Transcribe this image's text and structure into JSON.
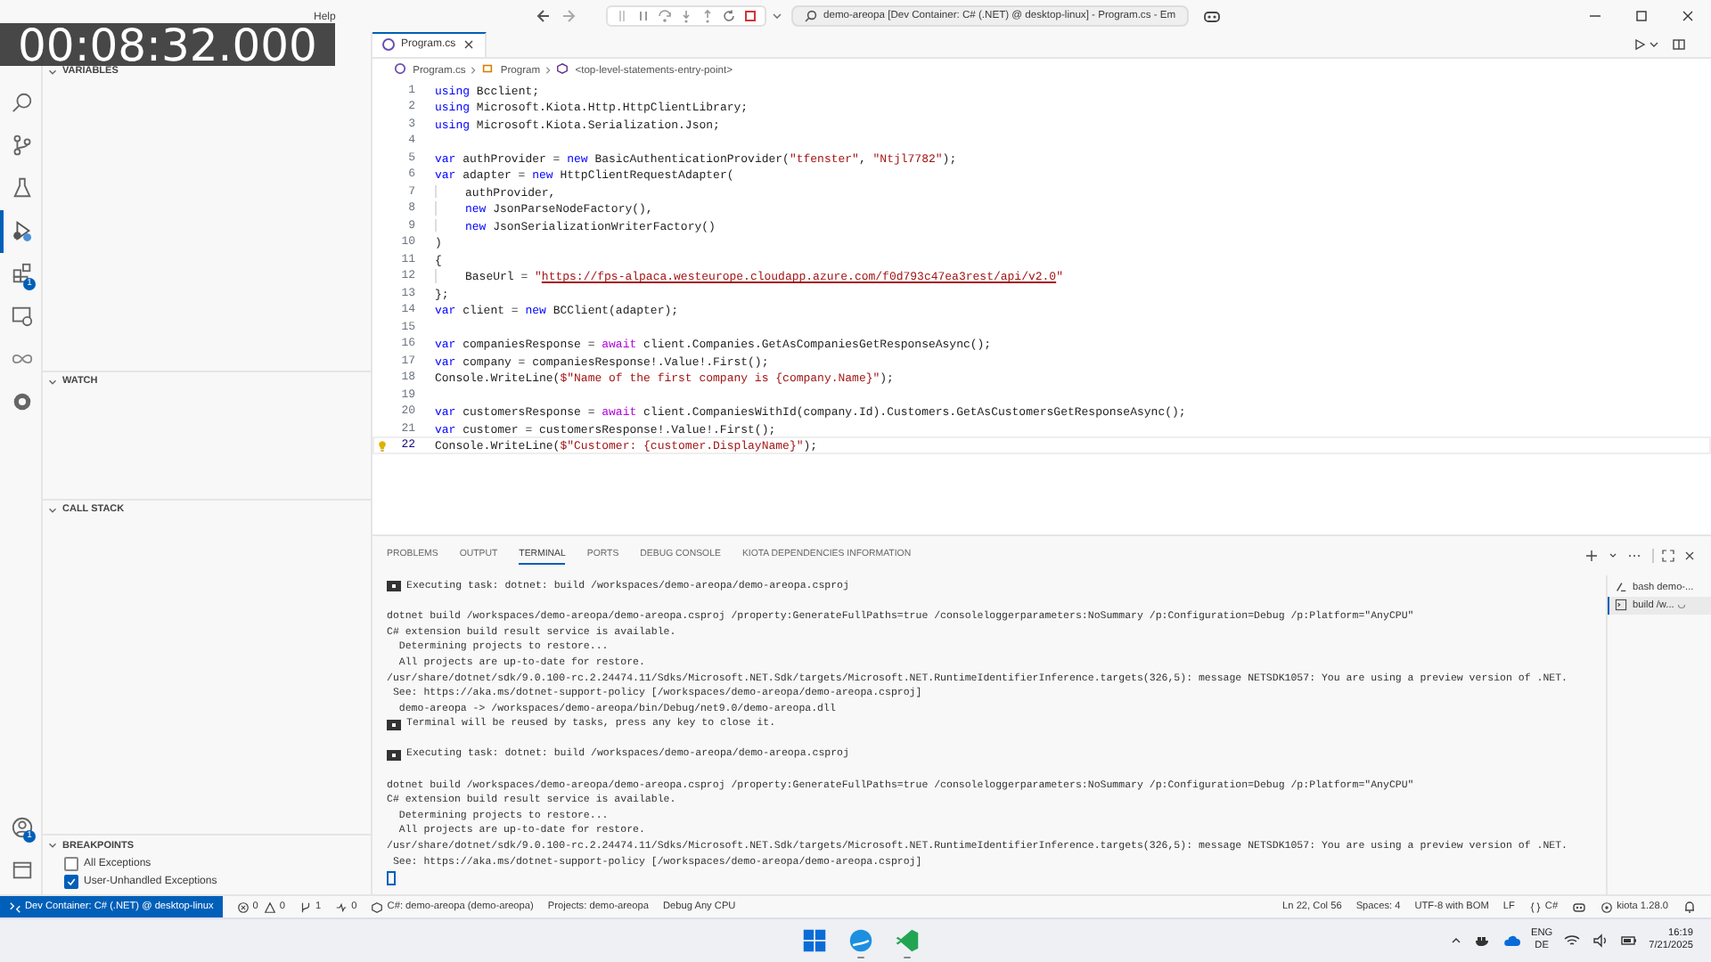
{
  "timer_overlay": "00:08:32.000",
  "title_bar": {
    "menu": [
      "Help"
    ],
    "command_center": "demo-areopa [Dev Container: C# (.NET) @ desktop-linux] - Program.cs - Em"
  },
  "activity_bar": {
    "top": [
      {
        "kind": "search",
        "selected": false
      },
      {
        "kind": "source-control",
        "selected": false
      },
      {
        "kind": "testing",
        "selected": false
      },
      {
        "kind": "run-debug",
        "selected": true
      },
      {
        "kind": "extensions",
        "selected": false,
        "badge": "1"
      },
      {
        "kind": "remote",
        "selected": false
      },
      {
        "kind": "infinity",
        "selected": false
      },
      {
        "kind": "gear",
        "selected": false
      }
    ],
    "bottom": [
      {
        "kind": "account",
        "selected": false,
        "badge": "1"
      },
      {
        "kind": "panel",
        "selected": false
      }
    ]
  },
  "sidebar": {
    "sections": [
      {
        "title": "VARIABLES",
        "expanded": true
      },
      {
        "title": "WATCH",
        "expanded": true
      },
      {
        "title": "CALL STACK",
        "expanded": true
      }
    ],
    "breakpoints": {
      "title": "BREAKPOINTS",
      "expanded": true,
      "items": [
        {
          "label": "All Exceptions",
          "checked": false
        },
        {
          "label": "User-Unhandled Exceptions",
          "checked": true
        }
      ]
    }
  },
  "editor": {
    "tabs": [
      {
        "label": "Program.cs",
        "selected": true
      }
    ],
    "breadcrumbs": [
      {
        "kind": "file",
        "text": "Program.cs"
      },
      {
        "kind": "class",
        "text": "Program"
      },
      {
        "kind": "method",
        "text": "<top-level-statements-entry-point>"
      }
    ],
    "lines": [
      {
        "number": "1",
        "current": false,
        "indent": false,
        "lightbulb": false,
        "tokens": [
          {
            "kind": "keyword",
            "text": "using"
          },
          {
            "kind": "plain",
            "text": " Bcclient;"
          }
        ]
      },
      {
        "number": "2",
        "current": false,
        "indent": false,
        "lightbulb": false,
        "tokens": [
          {
            "kind": "keyword",
            "text": "using"
          },
          {
            "kind": "plain",
            "text": " Microsoft.Kiota.Http.HttpClientLibrary;"
          }
        ]
      },
      {
        "number": "3",
        "current": false,
        "indent": false,
        "lightbulb": false,
        "tokens": [
          {
            "kind": "keyword",
            "text": "using"
          },
          {
            "kind": "plain",
            "text": " Microsoft.Kiota.Serialization.Json;"
          }
        ]
      },
      {
        "number": "4",
        "current": false,
        "indent": false,
        "lightbulb": false
      },
      {
        "number": "5",
        "current": false,
        "indent": false,
        "lightbulb": false,
        "tokens": [
          {
            "kind": "keyword",
            "text": "var"
          },
          {
            "kind": "plain",
            "text": " authProvider = "
          },
          {
            "kind": "keyword",
            "text": "new"
          },
          {
            "kind": "plain",
            "text": " BasicAuthenticationProvider("
          },
          {
            "kind": "string",
            "text": "\"tfenster\""
          },
          {
            "kind": "plain",
            "text": ", "
          },
          {
            "kind": "string",
            "text": "\"Ntjl7782\""
          },
          {
            "kind": "plain",
            "text": ");"
          }
        ]
      },
      {
        "number": "6",
        "current": false,
        "indent": false,
        "lightbulb": false,
        "tokens": [
          {
            "kind": "keyword",
            "text": "var"
          },
          {
            "kind": "plain",
            "text": " adapter = "
          },
          {
            "kind": "keyword",
            "text": "new"
          },
          {
            "kind": "plain",
            "text": " HttpClientRequestAdapter("
          }
        ]
      },
      {
        "number": "7",
        "current": false,
        "indent": true,
        "lightbulb": false,
        "tokens": [
          {
            "kind": "plain",
            "text": "authProvider,"
          }
        ]
      },
      {
        "number": "8",
        "current": false,
        "indent": true,
        "lightbulb": false,
        "tokens": [
          {
            "kind": "keyword",
            "text": "new"
          },
          {
            "kind": "plain",
            "text": " JsonParseNodeFactory(),"
          }
        ]
      },
      {
        "number": "9",
        "current": false,
        "indent": true,
        "lightbulb": false,
        "tokens": [
          {
            "kind": "keyword",
            "text": "new"
          },
          {
            "kind": "plain",
            "text": " JsonSerializationWriterFactory()"
          }
        ]
      },
      {
        "number": "10",
        "current": false,
        "indent": false,
        "lightbulb": false,
        "tokens": [
          {
            "kind": "plain",
            "text": ")"
          }
        ]
      },
      {
        "number": "11",
        "current": false,
        "indent": false,
        "lightbulb": false,
        "tokens": [
          {
            "kind": "plain",
            "text": "{"
          }
        ]
      },
      {
        "number": "12",
        "current": false,
        "indent": true,
        "lightbulb": false,
        "tokens": [
          {
            "kind": "plain",
            "text": "BaseUrl = "
          },
          {
            "kind": "string",
            "text": "\""
          },
          {
            "kind": "link",
            "text": "https://fps-alpaca.westeurope.cloudapp.azure.com/f0d793c47ea3rest/api/v2.0"
          },
          {
            "kind": "string",
            "text": "\""
          }
        ]
      },
      {
        "number": "13",
        "current": false,
        "indent": false,
        "lightbulb": false,
        "tokens": [
          {
            "kind": "plain",
            "text": "};"
          }
        ]
      },
      {
        "number": "14",
        "current": false,
        "indent": false,
        "lightbulb": false,
        "tokens": [
          {
            "kind": "keyword",
            "text": "var"
          },
          {
            "kind": "plain",
            "text": " client = "
          },
          {
            "kind": "keyword",
            "text": "new"
          },
          {
            "kind": "plain",
            "text": " BCClient(adapter);"
          }
        ]
      },
      {
        "number": "15",
        "current": false,
        "indent": false,
        "lightbulb": false
      },
      {
        "number": "16",
        "current": false,
        "indent": false,
        "lightbulb": false,
        "tokens": [
          {
            "kind": "keyword",
            "text": "var"
          },
          {
            "kind": "plain",
            "text": " companiesResponse = "
          },
          {
            "kind": "control",
            "text": "await"
          },
          {
            "kind": "plain",
            "text": " client.Companies.GetAsCompaniesGetResponseAsync();"
          }
        ]
      },
      {
        "number": "17",
        "current": false,
        "indent": false,
        "lightbulb": false,
        "tokens": [
          {
            "kind": "keyword",
            "text": "var"
          },
          {
            "kind": "plain",
            "text": " company = companiesResponse!.Value!.First();"
          }
        ]
      },
      {
        "number": "18",
        "current": false,
        "indent": false,
        "lightbulb": false,
        "tokens": [
          {
            "kind": "plain",
            "text": "Console.WriteLine("
          },
          {
            "kind": "string",
            "text": "$\"Name of the first company is {company.Name}\""
          },
          {
            "kind": "plain",
            "text": ");"
          }
        ]
      },
      {
        "number": "19",
        "current": false,
        "indent": false,
        "lightbulb": false
      },
      {
        "number": "20",
        "current": false,
        "indent": false,
        "lightbulb": false,
        "tokens": [
          {
            "kind": "keyword",
            "text": "var"
          },
          {
            "kind": "plain",
            "text": " customersResponse = "
          },
          {
            "kind": "control",
            "text": "await"
          },
          {
            "kind": "plain",
            "text": " client.CompaniesWithId(company.Id).Customers.GetAsCustomersGetResponseAsync();"
          }
        ]
      },
      {
        "number": "21",
        "current": false,
        "indent": false,
        "lightbulb": false,
        "tokens": [
          {
            "kind": "keyword",
            "text": "var"
          },
          {
            "kind": "plain",
            "text": " customer = customersResponse!.Value!.First();"
          }
        ]
      },
      {
        "number": "22",
        "current": true,
        "indent": false,
        "lightbulb": true,
        "tokens": [
          {
            "kind": "plain",
            "text": "Console.WriteLine("
          },
          {
            "kind": "string",
            "text": "$\"Customer: {customer.DisplayName}\""
          },
          {
            "kind": "plain",
            "text": ");"
          }
        ]
      }
    ]
  },
  "panel": {
    "tabs": [
      {
        "label": "PROBLEMS",
        "selected": false
      },
      {
        "label": "OUTPUT",
        "selected": false
      },
      {
        "label": "TERMINAL",
        "selected": true
      },
      {
        "label": "PORTS",
        "selected": false
      },
      {
        "label": "DEBUG CONSOLE",
        "selected": false
      },
      {
        "label": "KIOTA DEPENDENCIES INFORMATION",
        "selected": false
      }
    ],
    "terminal_lines": [
      {
        "kind": "task",
        "text": "Executing task: dotnet: build /workspaces/demo-areopa/demo-areopa.csproj"
      },
      {
        "kind": "blank"
      },
      {
        "kind": "output",
        "text": "dotnet build /workspaces/demo-areopa/demo-areopa.csproj /property:GenerateFullPaths=true /consoleloggerparameters:NoSummary /p:Configuration=Debug /p:Platform=\"AnyCPU\""
      },
      {
        "kind": "output",
        "text": "C# extension build result service is available."
      },
      {
        "kind": "output",
        "text": "  Determining projects to restore..."
      },
      {
        "kind": "output",
        "text": "  All projects are up-to-date for restore."
      },
      {
        "kind": "output",
        "text": "/usr/share/dotnet/sdk/9.0.100-rc.2.24474.11/Sdks/Microsoft.NET.Sdk/targets/Microsoft.NET.RuntimeIdentifierInference.targets(326,5): message NETSDK1057: You are using a preview version of .NET."
      },
      {
        "kind": "output",
        "text": " See: https://aka.ms/dotnet-support-policy [/workspaces/demo-areopa/demo-areopa.csproj]"
      },
      {
        "kind": "output",
        "text": "  demo-areopa -> /workspaces/demo-areopa/bin/Debug/net9.0/demo-areopa.dll"
      },
      {
        "kind": "task",
        "text": "Terminal will be reused by tasks, press any key to close it."
      },
      {
        "kind": "blank"
      },
      {
        "kind": "task",
        "text": "Executing task: dotnet: build /workspaces/demo-areopa/demo-areopa.csproj"
      },
      {
        "kind": "blank"
      },
      {
        "kind": "output",
        "text": "dotnet build /workspaces/demo-areopa/demo-areopa.csproj /property:GenerateFullPaths=true /consoleloggerparameters:NoSummary /p:Configuration=Debug /p:Platform=\"AnyCPU\""
      },
      {
        "kind": "output",
        "text": "C# extension build result service is available."
      },
      {
        "kind": "output",
        "text": "  Determining projects to restore..."
      },
      {
        "kind": "output",
        "text": "  All projects are up-to-date for restore."
      },
      {
        "kind": "output",
        "text": "/usr/share/dotnet/sdk/9.0.100-rc.2.24474.11/Sdks/Microsoft.NET.Sdk/targets/Microsoft.NET.RuntimeIdentifierInference.targets(326,5): message NETSDK1057: You are using a preview version of .NET."
      },
      {
        "kind": "output",
        "text": " See: https://aka.ms/dotnet-support-policy [/workspaces/demo-areopa/demo-areopa.csproj]"
      },
      {
        "kind": "cursor"
      }
    ],
    "terminals": [
      {
        "kind": "bash",
        "label": "bash demo-...",
        "selected": false,
        "busy": false
      },
      {
        "kind": "task",
        "label": "build /w...",
        "selected": true,
        "busy": true
      }
    ]
  },
  "status_bar": {
    "left": [
      {
        "kind": "remote",
        "text": "Dev Container: C# (.NET) @ desktop-linux"
      },
      {
        "kind": "errors",
        "text": "0"
      },
      {
        "kind": "warnings",
        "text": "0"
      },
      {
        "kind": "worktree",
        "text": "1"
      },
      {
        "kind": "ports",
        "text": "0"
      },
      {
        "kind": "project",
        "text": "C#: demo-areopa (demo-areopa)"
      },
      {
        "kind": "plain",
        "text": "Projects: demo-areopa"
      },
      {
        "kind": "plain",
        "text": "Debug Any CPU"
      }
    ],
    "right": [
      {
        "kind": "plain",
        "text": "Ln 22, Col 56"
      },
      {
        "kind": "plain",
        "text": "Spaces: 4"
      },
      {
        "kind": "plain",
        "text": "UTF-8 with BOM"
      },
      {
        "kind": "plain",
        "text": "LF"
      },
      {
        "kind": "language",
        "text": "C#"
      },
      {
        "kind": "copilot"
      },
      {
        "kind": "kiota",
        "text": "kiota 1.28.0"
      },
      {
        "kind": "bell"
      }
    ]
  },
  "taskbar": {
    "apps": [
      {
        "kind": "start",
        "running": false
      },
      {
        "kind": "browser",
        "running": true
      },
      {
        "kind": "vscode",
        "running": true
      }
    ],
    "language": "ENG",
    "layout": "DE",
    "time": "16:19",
    "date": "7/21/2025"
  }
}
